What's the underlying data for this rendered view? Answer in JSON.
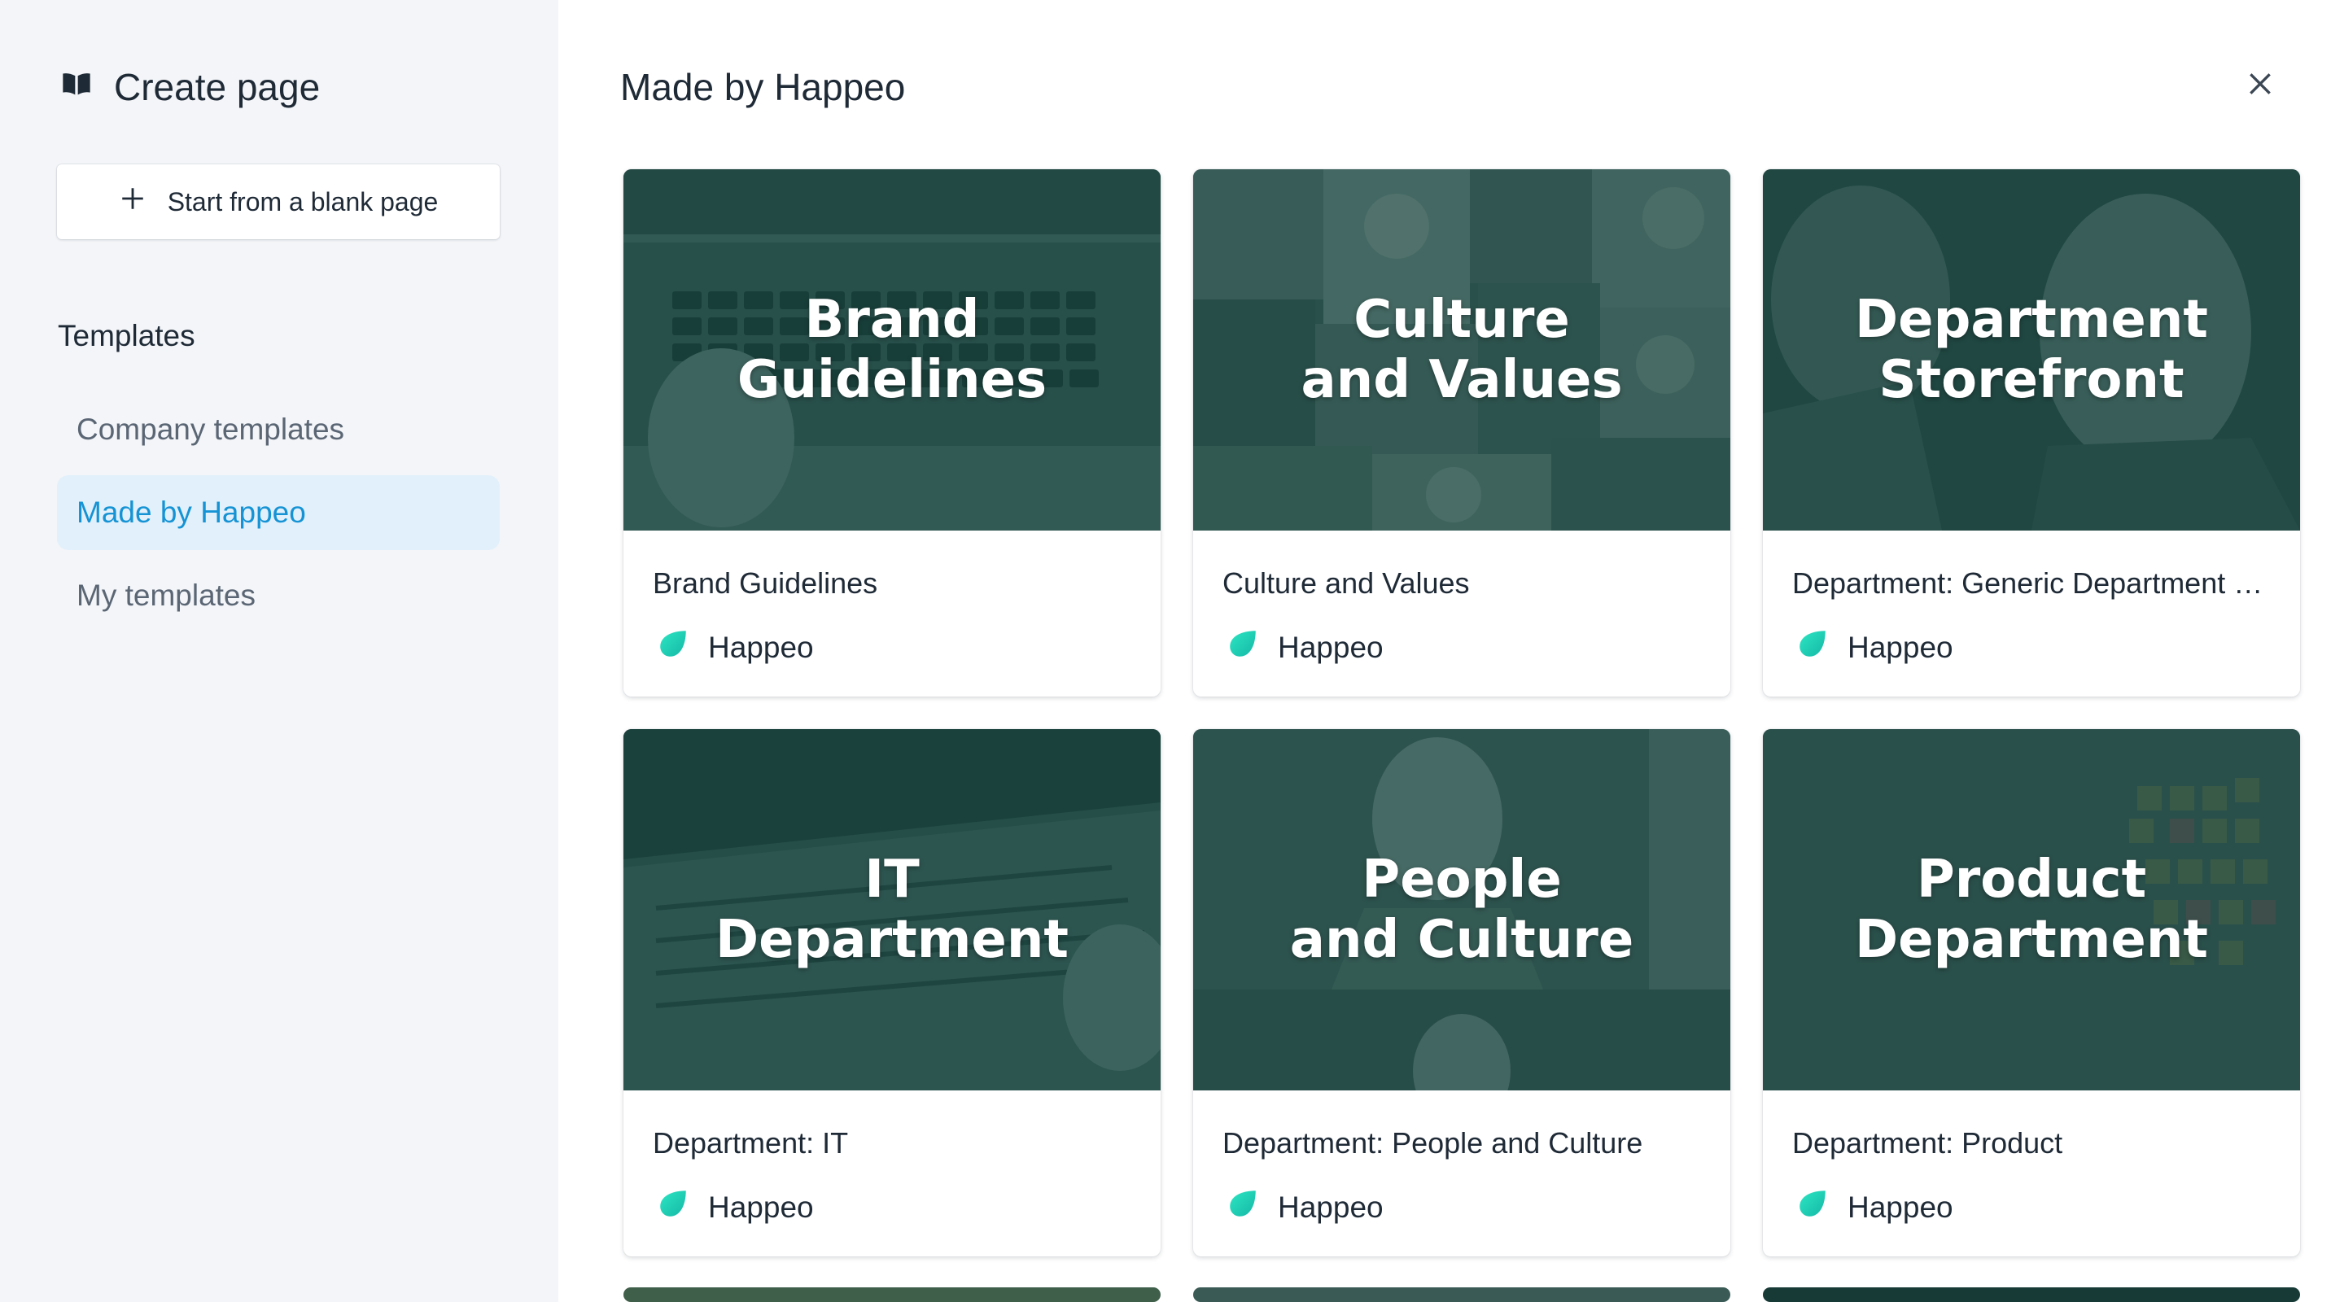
{
  "sidebar": {
    "title": "Create page",
    "title_icon": "book-icon",
    "blank_button": "Start from a blank page",
    "templates_heading": "Templates",
    "nav": [
      {
        "label": "Company templates",
        "active": false
      },
      {
        "label": "Made by Happeo",
        "active": true
      },
      {
        "label": "My templates",
        "active": false
      }
    ]
  },
  "main": {
    "title": "Made by Happeo",
    "close_icon": "close-icon",
    "cards": [
      {
        "thumb_line1": "Brand",
        "thumb_line2": "Guidelines",
        "name": "Brand Guidelines",
        "author": "Happeo"
      },
      {
        "thumb_line1": "Culture",
        "thumb_line2": "and Values",
        "name": "Culture and Values",
        "author": "Happeo"
      },
      {
        "thumb_line1": "Department",
        "thumb_line2": "Storefront",
        "name": "Department: Generic Department Storefront",
        "author": "Happeo"
      },
      {
        "thumb_line1": "IT",
        "thumb_line2": "Department",
        "name": "Department: IT",
        "author": "Happeo"
      },
      {
        "thumb_line1": "People",
        "thumb_line2": "and Culture",
        "name": "Department: People and Culture",
        "author": "Happeo"
      },
      {
        "thumb_line1": "Product",
        "thumb_line2": "Department",
        "name": "Department: Product",
        "author": "Happeo"
      }
    ]
  },
  "colors": {
    "accent": "#1593d4",
    "active_bg": "#e2f0fb",
    "sidebar_bg": "#f3f5f8",
    "thumb_overlay": "#103e38",
    "logo_gradient_start": "#2ee6c3",
    "logo_gradient_end": "#14b8a6"
  }
}
